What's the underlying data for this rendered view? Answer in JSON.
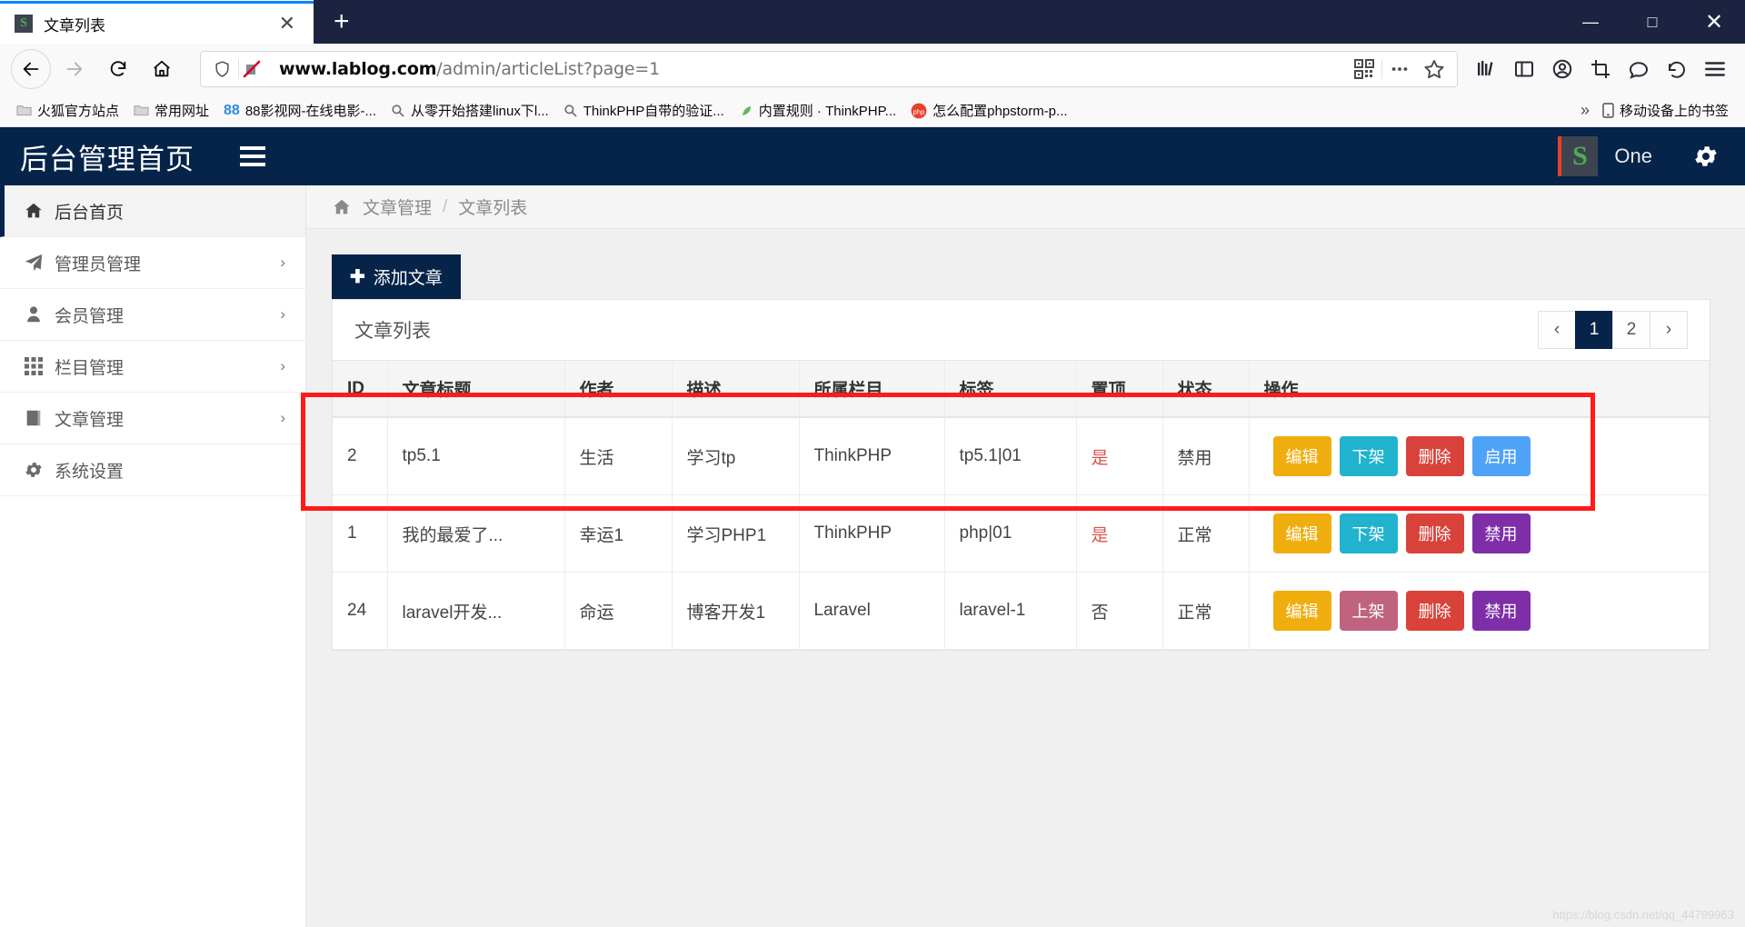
{
  "browser": {
    "tab": {
      "title": "文章列表",
      "favicon_letter": "S",
      "close_label": "✕"
    },
    "newtab_label": "+",
    "window_controls": {
      "minimize": "—",
      "maximize": "□",
      "close": "✕"
    },
    "nav": {
      "back": "back-arrow",
      "forward": "forward-arrow",
      "reload": "reload-icon",
      "home": "home-icon"
    },
    "url": {
      "domain": "www.lablog.com",
      "path": "/admin/articleList?page=1",
      "full": "www.lablog.com/admin/articleList?page=1"
    },
    "bookmarks": [
      {
        "label": "火狐官方站点",
        "icon": "folder-icon"
      },
      {
        "label": "常用网址",
        "icon": "folder-icon"
      },
      {
        "label": "88影视网-在线电影-...",
        "icon": "88-icon"
      },
      {
        "label": "从零开始搭建linux下l...",
        "icon": "search-bookmark-icon"
      },
      {
        "label": "ThinkPHP自带的验证...",
        "icon": "search-bookmark-icon"
      },
      {
        "label": "内置规则 · ThinkPHP...",
        "icon": "leaf-icon"
      },
      {
        "label": "怎么配置phpstorm-p...",
        "icon": "php-icon"
      }
    ],
    "bookmarks_overflow": "»",
    "mobile_bookmarks": "移动设备上的书签"
  },
  "app": {
    "brand": "后台管理首页",
    "user": {
      "avatar_letter": "S",
      "name": "One"
    },
    "sidebar": [
      {
        "label": "后台首页",
        "icon": "home-icon",
        "active": true,
        "chevron": ""
      },
      {
        "label": "管理员管理",
        "icon": "paper-plane-icon",
        "active": false,
        "chevron": "›"
      },
      {
        "label": "会员管理",
        "icon": "user-icon",
        "active": false,
        "chevron": "›"
      },
      {
        "label": "栏目管理",
        "icon": "grid-icon",
        "active": false,
        "chevron": "›"
      },
      {
        "label": "文章管理",
        "icon": "book-icon",
        "active": false,
        "chevron": "›"
      },
      {
        "label": "系统设置",
        "icon": "gear-icon",
        "active": false,
        "chevron": ""
      }
    ],
    "breadcrumb": {
      "home_icon": "home-icon",
      "parent": "文章管理",
      "separator": "/",
      "current": "文章列表"
    },
    "add_button": {
      "plus": "✚",
      "label": "添加文章"
    },
    "panel_title": "文章列表",
    "pagination": {
      "prev": "‹",
      "pages": [
        "1",
        "2"
      ],
      "active": "1",
      "next": "›"
    },
    "table": {
      "headers": [
        "ID",
        "文章标题",
        "作者",
        "描述",
        "所属栏目",
        "标签",
        "置顶",
        "状态",
        "操作"
      ],
      "rows": [
        {
          "id": "2",
          "title": "tp5.1",
          "author": "生活",
          "desc": "学习tp",
          "category": "ThinkPHP",
          "tags": "tp5.1|01",
          "top": "是",
          "status": "禁用",
          "actions": [
            {
              "label": "编辑",
              "color": "#f0ad0e"
            },
            {
              "label": "下架",
              "color": "#21b3cd"
            },
            {
              "label": "删除",
              "color": "#d9423a"
            },
            {
              "label": "启用",
              "color": "#4fa3f7"
            }
          ]
        },
        {
          "id": "1",
          "title": "我的最爱了...",
          "author": "幸运1",
          "desc": "学习PHP1",
          "category": "ThinkPHP",
          "tags": "php|01",
          "top": "是",
          "status": "正常",
          "actions": [
            {
              "label": "编辑",
              "color": "#f0ad0e"
            },
            {
              "label": "下架",
              "color": "#21b3cd"
            },
            {
              "label": "删除",
              "color": "#d9423a"
            },
            {
              "label": "禁用",
              "color": "#7e2fa8"
            }
          ]
        },
        {
          "id": "24",
          "title": "laravel开发...",
          "author": "命运",
          "desc": "博客开发1",
          "category": "Laravel",
          "tags": "laravel-1",
          "top": "否",
          "status": "正常",
          "actions": [
            {
              "label": "编辑",
              "color": "#f0ad0e"
            },
            {
              "label": "上架",
              "color": "#c0637f"
            },
            {
              "label": "删除",
              "color": "#d9423a"
            },
            {
              "label": "禁用",
              "color": "#7e2fa8"
            }
          ]
        }
      ]
    },
    "annotation_color": "#ff1a1a"
  },
  "watermark": "https://blog.csdn.net/qq_44799963"
}
